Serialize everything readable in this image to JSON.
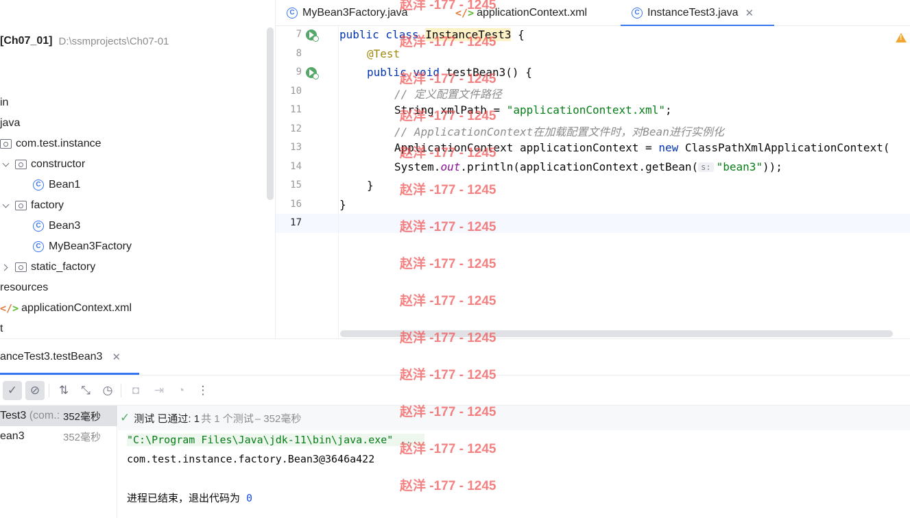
{
  "editor_tabs": [
    {
      "label": "MyBean3Factory.java",
      "icon": "class-icon"
    },
    {
      "label": "applicationContext.xml",
      "icon": "xml-icon"
    },
    {
      "label": "InstanceTest3.java",
      "icon": "class-icon",
      "active": true,
      "close": "✕"
    }
  ],
  "project": {
    "root_name": "[Ch07_01]",
    "root_path": "D:\\ssmprojects\\Ch07-01",
    "tree": {
      "main": "in",
      "java": "java",
      "pkg": "com.test.instance",
      "constructor": "constructor",
      "bean1": "Bean1",
      "factory": "factory",
      "bean3": "Bean3",
      "mybean3factory": "MyBean3Factory",
      "static_factory": "static_factory",
      "resources": "resources",
      "appctx": "applicationContext.xml",
      "test": "t"
    }
  },
  "editor": {
    "line_numbers": [
      "7",
      "8",
      "9",
      "10",
      "11",
      "12",
      "13",
      "14",
      "15",
      "16",
      "17"
    ],
    "code": {
      "l7_kw": "public class ",
      "l7_cls": "InstanceTest3",
      "l7_rest": " {",
      "l8_ann": "@Test",
      "l9_kw": "public void ",
      "l9_rest": "testBean3() {",
      "l10_cmt": "// 定义配置文件路径",
      "l11_a": "String xmlPath = ",
      "l11_str": "\"applicationContext.xml\"",
      "l11_b": ";",
      "l12_cmt": "// ApplicationContext在加载配置文件时，对Bean进行实例化",
      "l13_a": "ApplicationContext applicationContext = ",
      "l13_kw": "new ",
      "l13_b": "ClassPathXmlApplicationContext(",
      "l14_a": "System.",
      "l14_fld": "out",
      "l14_b": ".println(applicationContext.getBean(",
      "l14_hint": "s:",
      "l14_str": "\"bean3\"",
      "l14_c": "));",
      "l15": "}",
      "l16": "}"
    }
  },
  "run": {
    "tab_label": "anceTest3.testBean3",
    "tab_close": "✕",
    "toolbar": [
      {
        "name": "passed-filter-icon",
        "glyph": "✓"
      },
      {
        "name": "ignored-filter-icon",
        "glyph": "⊘"
      },
      {
        "name": "sort-icon",
        "glyph": "⇅"
      },
      {
        "name": "collapse-icon",
        "glyph": "⤡"
      },
      {
        "name": "history-icon",
        "glyph": "◷"
      },
      {
        "name": "screenshot-icon",
        "glyph": "◘"
      },
      {
        "name": "import-icon",
        "glyph": "⇥"
      },
      {
        "name": "coverage-icon",
        "glyph": "◔"
      },
      {
        "name": "more-icon",
        "glyph": "⋮"
      }
    ],
    "tests": [
      {
        "name": "Test3",
        "pkg": " (com.:",
        "time": "352毫秒"
      },
      {
        "name": "ean3",
        "pkg": "",
        "time": "352毫秒"
      }
    ],
    "status": {
      "check": "✓",
      "passed_label": "测试 已通过: 1",
      "total": "共 1 个测试",
      "duration": " – 352毫秒"
    },
    "console": {
      "cmd": "\"C:\\Program Files\\Java\\jdk-11\\bin\\java.exe\"",
      "cmd_more": " ...",
      "output": "com.test.instance.factory.Bean3@3646a422",
      "exit_text": "进程已结束，退出代码为 ",
      "exit_code": "0"
    }
  },
  "watermark": "赵洋 -177 - 1245",
  "colors": {
    "accent": "#3574f0",
    "keyword": "#0033b3",
    "string": "#067d17",
    "annotation": "#9e880d",
    "comment": "#8c8c8c",
    "pass": "#55a76a",
    "watermark": "#f05050"
  }
}
